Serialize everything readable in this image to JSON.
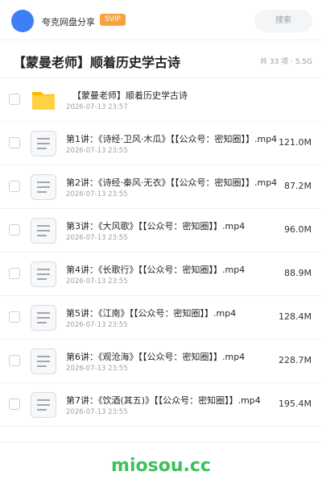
{
  "header": {
    "username": "夸克网盘分享",
    "badge": "SVIP",
    "search_label": "搜索"
  },
  "share": {
    "title": "【蒙曼老师】顺着历史学古诗",
    "meta": "共 33 项 · 5.5G"
  },
  "items": [
    {
      "type": "folder",
      "icon": "folder-icon",
      "name": "【蒙曼老师】顺着历史学古诗",
      "date": "2026-07-13 23:57",
      "size": ""
    },
    {
      "type": "file",
      "icon": "document-icon",
      "name": "第1讲：《诗经·卫风·木瓜》【【公众号：密知圈】】.mp4",
      "date": "2026-07-13 23:55",
      "size": "121.0M"
    },
    {
      "type": "file",
      "icon": "document-icon",
      "name": "第2讲：《诗经·秦风·无衣》【【公众号：密知圈】】.mp4",
      "date": "2026-07-13 23:55",
      "size": "87.2M"
    },
    {
      "type": "file",
      "icon": "document-icon",
      "name": "第3讲：《大风歌》【【公众号：密知圈】】.mp4",
      "date": "2026-07-13 23:55",
      "size": "96.0M"
    },
    {
      "type": "file",
      "icon": "document-icon",
      "name": "第4讲：《长歌行》【【公众号：密知圈】】.mp4",
      "date": "2026-07-13 23:55",
      "size": "88.9M"
    },
    {
      "type": "file",
      "icon": "document-icon",
      "name": "第5讲：《江南》【【公众号：密知圈】】.mp4",
      "date": "2026-07-13 23:55",
      "size": "128.4M"
    },
    {
      "type": "file",
      "icon": "document-icon",
      "name": "第6讲：《观沧海》【【公众号：密知圈】】.mp4",
      "date": "2026-07-13 23:55",
      "size": "228.7M"
    },
    {
      "type": "file",
      "icon": "document-icon",
      "name": "第7讲：《饮酒(其五)》【【公众号：密知圈】】.mp4",
      "date": "2026-07-13 23:55",
      "size": "195.4M"
    }
  ],
  "footer": {
    "watermark": "miosou.cc"
  },
  "colors": {
    "avatar": "#3f7ff6",
    "badge": "#f6a33b",
    "folder": "#ffc933",
    "watermark": "#3cc25a"
  }
}
